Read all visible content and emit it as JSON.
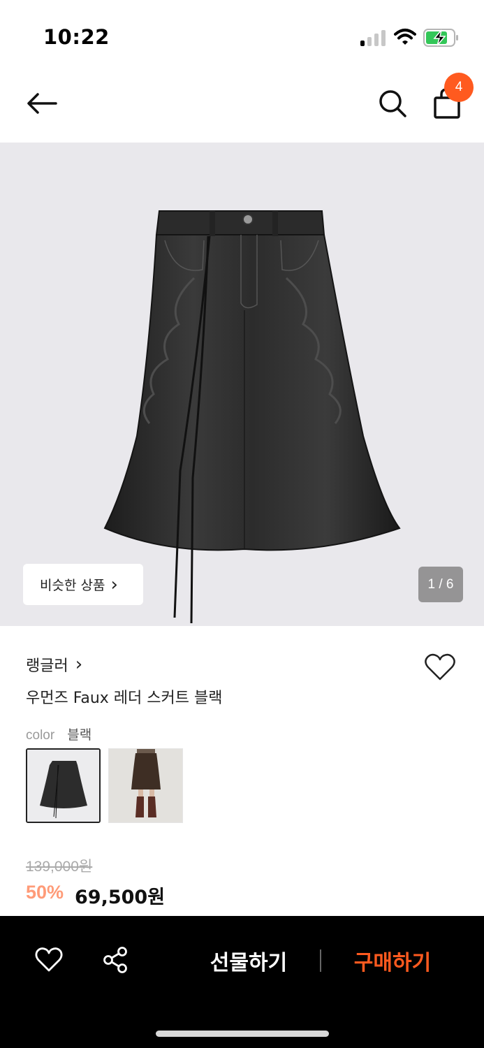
{
  "status_bar": {
    "time": "10:22"
  },
  "header": {
    "cart_count": "4"
  },
  "product_image": {
    "similar_label": "비슷한 상품",
    "similar_chevron": "›",
    "counter": "1 / 6"
  },
  "product": {
    "brand": "랭글러",
    "brand_chevron": "›",
    "name": "우먼즈 Faux 레더 스커트 블랙",
    "color_label": "color",
    "color_value": "블랙",
    "original_price": "139,000원",
    "discount": "50%",
    "price": "69,500원"
  },
  "bottom_bar": {
    "gift_label": "선물하기",
    "buy_label": "구매하기"
  },
  "colors": {
    "accent": "#ff5a1f",
    "badge": "#ff5a1f",
    "bottom_bar_bg": "#000000"
  },
  "icons": [
    "back-arrow-icon",
    "search-icon",
    "shopping-bag-icon",
    "heart-icon",
    "share-icon"
  ]
}
